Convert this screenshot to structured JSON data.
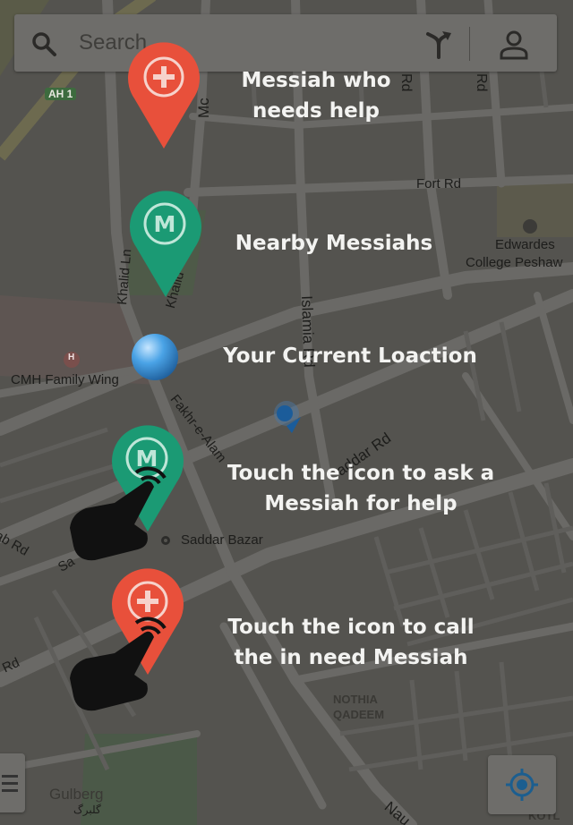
{
  "search": {
    "placeholder": "Search"
  },
  "map": {
    "labels": {
      "ah1": "AH 1",
      "fort_rd": "Fort Rd",
      "edwardes_1": "Edwardes",
      "edwardes_2": "College Peshaw",
      "khalid_ln": "Khalid Ln",
      "khalid_2": "Khalid",
      "islamia_rd": "Islamia Rd",
      "cmh": "CMH Family Wing",
      "fakhr": "Fakhr-e-Alam",
      "saddar_rd": "addar Rd",
      "saddar_bazar": "Saddar Bazar",
      "ab_rd": "ab Rd",
      "sa": "Sa",
      "rd_left": "Rd",
      "nothia_1": "NOTHIA",
      "nothia_2": "QADEEM",
      "mc": "Mc",
      "rd_top1": "Rd",
      "rd_top2": "Rd",
      "gulberg": "Gulberg",
      "gulberg_urdu": "گلبرگ",
      "nau": "Nau",
      "kotl": "KOTL",
      "h_marker": "H"
    }
  },
  "legend": {
    "help": {
      "line1": "Messiah who",
      "line2": "needs help",
      "pin_symbol": "+",
      "color": "#e8503b"
    },
    "nearby": {
      "line1": "Nearby Messiahs",
      "pin_symbol": "M",
      "color": "#1b9a74"
    },
    "current": {
      "line1": "Your Current Loaction",
      "color": "#4aa3e6"
    },
    "ask": {
      "line1": "Touch the icon to ask a",
      "line2": "Messiah for help",
      "pin_symbol": "M",
      "color": "#1b9a74"
    },
    "call": {
      "line1": "Touch the icon to call",
      "line2": "the in need Messiah",
      "pin_symbol": "+",
      "color": "#e8503b"
    }
  },
  "icons": {
    "search": "search-icon",
    "directions": "directions-icon",
    "account": "account-icon",
    "menu": "menu-icon",
    "my_location": "my-location-icon",
    "hand": "pointing-hand-icon"
  }
}
